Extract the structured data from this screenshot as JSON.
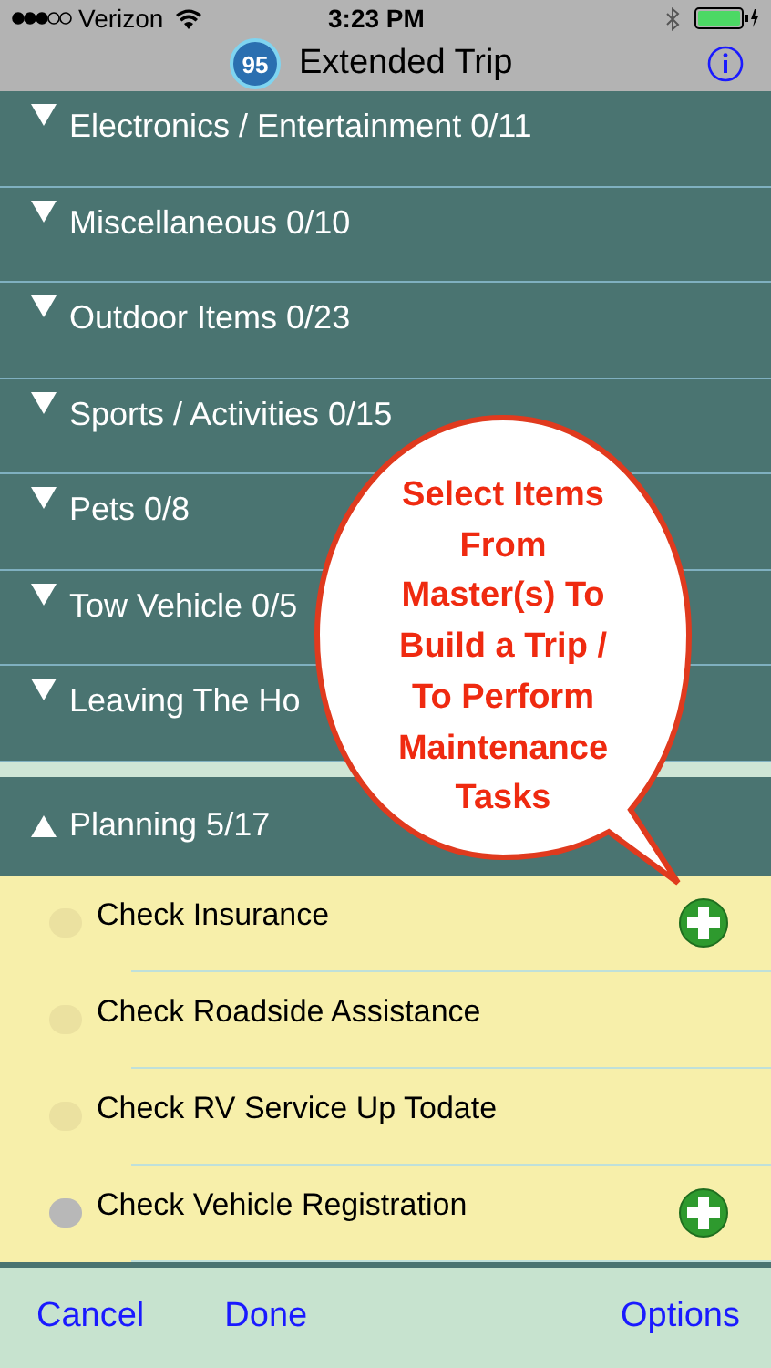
{
  "status_bar": {
    "carrier": "Verizon",
    "time": "3:23 PM"
  },
  "nav": {
    "badge": "95",
    "title": "Extended Trip"
  },
  "sections": [
    {
      "label": "Electronics / Entertainment 0/11",
      "expanded": false
    },
    {
      "label": "Miscellaneous 0/10",
      "expanded": false
    },
    {
      "label": "Outdoor Items 0/23",
      "expanded": false
    },
    {
      "label": "Sports / Activities 0/15",
      "expanded": false
    },
    {
      "label": "Pets 0/8",
      "expanded": false
    },
    {
      "label": "Tow Vehicle 0/5",
      "expanded": false
    },
    {
      "label": "Leaving The Ho",
      "expanded": false
    },
    {
      "label": "Planning 5/17",
      "expanded": true,
      "items": [
        {
          "label": "Check Insurance",
          "selected": false,
          "add": true
        },
        {
          "label": "Check Roadside Assistance",
          "selected": false,
          "add": false
        },
        {
          "label": "Check RV Service Up Todate",
          "selected": false,
          "add": false
        },
        {
          "label": "Check Vehicle Registration",
          "selected": true,
          "add": true
        }
      ]
    }
  ],
  "callout": [
    "Select Items",
    "From",
    "Master(s) To",
    "Build a Trip /",
    "To Perform",
    "Maintenance",
    "Tasks"
  ],
  "toolbar": {
    "left": [
      "Cancel",
      "Done"
    ],
    "right": "Options"
  }
}
